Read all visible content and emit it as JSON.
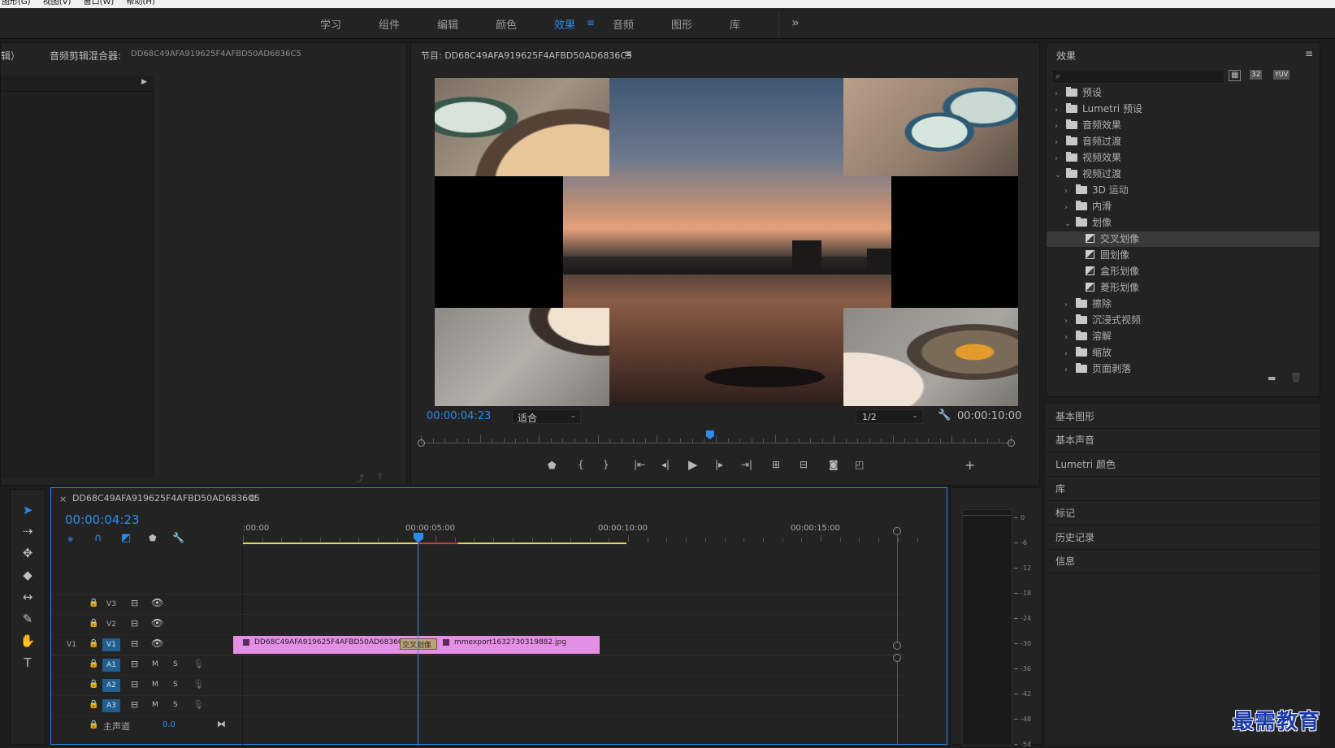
{
  "menubar": {
    "items": [
      "图形(G)",
      "视图(V)",
      "窗口(W)",
      "帮助(H)"
    ]
  },
  "workspaces": {
    "items": [
      "学习",
      "组件",
      "编辑",
      "颜色",
      "效果",
      "音频",
      "图形",
      "库"
    ],
    "active": "效果",
    "overflow": "»"
  },
  "source_panel": {
    "tab_partial": "辑）",
    "title": "音频剪辑混合器:",
    "clip": "DD68C49AFA919625F4AFBD50AD6836C5"
  },
  "program": {
    "title": "节目: DD68C49AFA919625F4AFBD50AD6836C5",
    "timecode": "00:00:04:23",
    "fit": "适合",
    "resolution": "1/2",
    "duration": "00:00:10:00",
    "playhead_fraction": 0.49
  },
  "timeline": {
    "sequence": "DD68C49AFA919625F4AFBD50AD6836C5",
    "timecode": "00:00:04:23",
    "ruler": [
      ":00:00",
      "00:00:05:00",
      "00:00:10:00",
      "00:00:15:00"
    ],
    "tracks_video": [
      {
        "name": "V3"
      },
      {
        "name": "V2"
      },
      {
        "name": "V1",
        "source": "V1"
      }
    ],
    "tracks_audio": [
      {
        "name": "A1"
      },
      {
        "name": "A2"
      },
      {
        "name": "A3"
      }
    ],
    "track_ms": {
      "m": "M",
      "s": "S"
    },
    "master": {
      "label": "主声道",
      "value": "0.0"
    },
    "clip1": "DD68C49AFA919625F4AFBD50AD6836C5.jp",
    "transition": "交叉划像",
    "clip2": "mmexport1632730319882.jpg"
  },
  "effects": {
    "title": "效果",
    "search_placeholder": "",
    "badges": [
      "32",
      "YUV"
    ],
    "tree": [
      {
        "label": "预设",
        "level": 0,
        "type": "special",
        "open": false
      },
      {
        "label": "Lumetri 预设",
        "level": 0,
        "type": "special",
        "open": false
      },
      {
        "label": "音频效果",
        "level": 0,
        "type": "folder",
        "open": false
      },
      {
        "label": "音频过渡",
        "level": 0,
        "type": "folder",
        "open": false
      },
      {
        "label": "视频效果",
        "level": 0,
        "type": "folder",
        "open": false
      },
      {
        "label": "视频过渡",
        "level": 0,
        "type": "folder",
        "open": true
      },
      {
        "label": "3D 运动",
        "level": 1,
        "type": "folder",
        "open": false
      },
      {
        "label": "内滑",
        "level": 1,
        "type": "folder",
        "open": false
      },
      {
        "label": "划像",
        "level": 1,
        "type": "folder",
        "open": true
      },
      {
        "label": "交叉划像",
        "level": 2,
        "type": "fx",
        "selected": true
      },
      {
        "label": "圆划像",
        "level": 2,
        "type": "fx"
      },
      {
        "label": "盒形划像",
        "level": 2,
        "type": "fx"
      },
      {
        "label": "菱形划像",
        "level": 2,
        "type": "fx"
      },
      {
        "label": "擦除",
        "level": 1,
        "type": "folder",
        "open": false
      },
      {
        "label": "沉浸式视频",
        "level": 1,
        "type": "folder",
        "open": false
      },
      {
        "label": "溶解",
        "level": 1,
        "type": "folder",
        "open": false
      },
      {
        "label": "缩放",
        "level": 1,
        "type": "folder",
        "open": false
      },
      {
        "label": "页面剥落",
        "level": 1,
        "type": "folder",
        "open": false
      }
    ]
  },
  "side_sections": [
    "基本图形",
    "基本声音",
    "Lumetri 颜色",
    "库",
    "标记",
    "历史记录",
    "信息"
  ],
  "meter": {
    "labels": [
      "0",
      "-6",
      "-12",
      "-18",
      "-24",
      "-30",
      "-36",
      "-42",
      "-48",
      "-54"
    ]
  },
  "watermark": "最需教育",
  "colors": {
    "accent": "#2d8ceb",
    "clip": "#e38fe3",
    "work_area": "#e8d84a"
  }
}
